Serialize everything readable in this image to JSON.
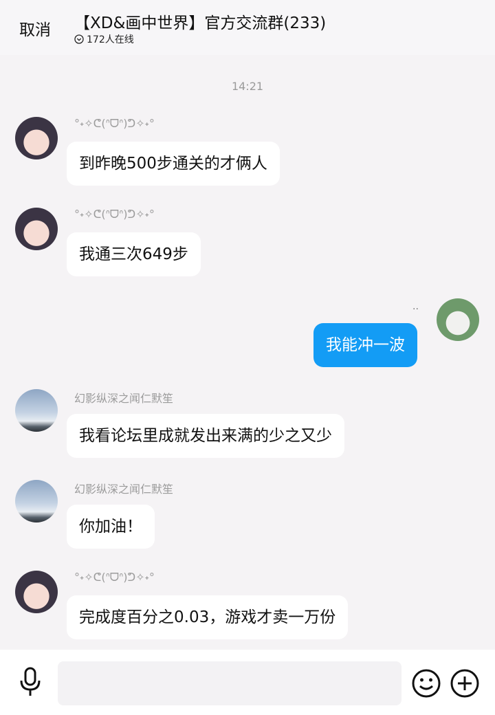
{
  "header": {
    "cancel_label": "取消",
    "title": "【XD&画中世界】官方交流群(233)",
    "online_text": "172人在线",
    "online_icon": "chevron-circle-icon"
  },
  "chat": {
    "timestamp": "14:21",
    "messages": [
      {
        "sender": "°˖✧ᕦ(ᐢᗜᐢ)ᕤ✧˖°",
        "text": "到昨晚500步通关的才俩人",
        "avatar": "anime-girl-avatar",
        "side": "left"
      },
      {
        "sender": "°˖✧ᕦ(ᐢᗜᐢ)ᕤ✧˖°",
        "text": "我通三次649步",
        "avatar": "anime-girl-avatar",
        "side": "left"
      },
      {
        "sender": "··",
        "text": "我能冲一波",
        "avatar": "green-hood-avatar",
        "side": "right"
      },
      {
        "sender": "幻影纵深之闻仁默笙",
        "text": "我看论坛里成就发出来满的少之又少",
        "avatar": "sky-avatar",
        "side": "left"
      },
      {
        "sender": "幻影纵深之闻仁默笙",
        "text": "你加油！",
        "avatar": "sky-avatar",
        "side": "left"
      },
      {
        "sender": "°˖✧ᕦ(ᐢᗜᐢ)ᕤ✧˖°",
        "text": "完成度百分之0.03，游戏才卖一万份",
        "avatar": "anime-girl-avatar",
        "side": "left"
      }
    ]
  },
  "composer": {
    "placeholder": "",
    "voice_icon": "microphone-icon",
    "emoji_icon": "emoji-icon",
    "plus_icon": "plus-circle-icon"
  },
  "colors": {
    "accent": "#139cf5",
    "background": "#f5f3f5"
  }
}
